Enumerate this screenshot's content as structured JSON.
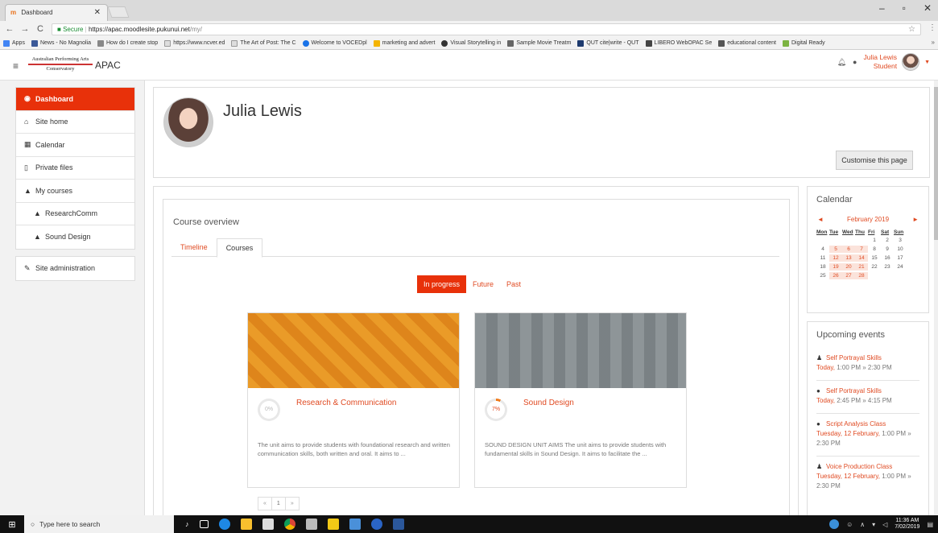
{
  "browser": {
    "tab_title": "Dashboard",
    "secure_label": "Secure",
    "url_host": "https://apac.moodlesite.pukunui.net",
    "url_path": "/my/",
    "bookmarks": [
      "Apps",
      "News - No Magnolia",
      "How do I create stop",
      "https://www.ncver.ed",
      "The Art of Post: The C",
      "Welcome to VOCEDpl",
      "marketing and advert",
      "Visual Storytelling in",
      "Sample Movie Treatm",
      "QUT cite|write - QUT",
      "LIBERO WebOPAC Se",
      "educational content",
      "Digital Ready"
    ]
  },
  "navbar": {
    "logo_line1": "Australian Performing Arts",
    "logo_line2": "Conservatory",
    "site_name": "APAC",
    "user_name": "Julia Lewis",
    "user_role": "Student"
  },
  "drawer": {
    "items": [
      {
        "label": "Dashboard",
        "icon": "dashboard-icon"
      },
      {
        "label": "Site home",
        "icon": "home-icon"
      },
      {
        "label": "Calendar",
        "icon": "calendar-icon"
      },
      {
        "label": "Private files",
        "icon": "file-icon"
      },
      {
        "label": "My courses",
        "icon": "graduation-cap-icon"
      },
      {
        "label": "ResearchComm",
        "icon": "graduation-cap-icon"
      },
      {
        "label": "Sound Design",
        "icon": "graduation-cap-icon"
      }
    ],
    "admin": {
      "label": "Site administration",
      "icon": "wrench-icon"
    }
  },
  "header": {
    "name": "Julia Lewis",
    "customise_label": "Customise this page"
  },
  "overview": {
    "title": "Course overview",
    "tabs": [
      "Timeline",
      "Courses"
    ],
    "active_tab": "Courses",
    "filters": [
      "In progress",
      "Future",
      "Past"
    ],
    "active_filter": "In progress",
    "courses": [
      {
        "title": "Research & Communication",
        "progress": "0%",
        "description": "The unit aims to provide students with foundational research and written communication skills, both written and oral. It aims to ...",
        "image_color": "#f2c15a"
      },
      {
        "title": "Sound Design",
        "progress": "7%",
        "description": "SOUND DESIGN UNIT AIMS  The unit aims to provide students with fundamental skills in Sound Design.  It aims to facilitate the ...",
        "image_color": "#b8bdbf"
      }
    ],
    "pager": [
      "«",
      "1",
      "»"
    ]
  },
  "calendar": {
    "title": "Calendar",
    "prev": "◄",
    "month": "February 2019",
    "next": "►",
    "weekdays": [
      "Mon",
      "Tue",
      "Wed",
      "Thu",
      "Fri",
      "Sat",
      "Sun"
    ],
    "days": [
      "",
      "",
      "",
      "",
      "1",
      "2",
      "3",
      "4",
      "5",
      "6",
      "7",
      "8",
      "9",
      "10",
      "11",
      "12",
      "13",
      "14",
      "15",
      "16",
      "17",
      "18",
      "19",
      "20",
      "21",
      "22",
      "23",
      "24",
      "25",
      "26",
      "27",
      "28",
      "",
      "",
      ""
    ],
    "event_days": [
      "5",
      "6",
      "7",
      "12",
      "13",
      "14",
      "19",
      "20",
      "21",
      "26",
      "27",
      "28"
    ]
  },
  "events": {
    "title": "Upcoming events",
    "items": [
      {
        "name": "Self Portrayal Skills",
        "date_link": "Today,",
        "time": "1:00 PM » 2:30 PM",
        "icon": "user-icon"
      },
      {
        "name": "Self Portrayal Skills",
        "date_link": "Today,",
        "time": "2:45 PM » 4:15 PM",
        "icon": "globe-icon"
      },
      {
        "name": "Script Analysis Class",
        "date_link": "Tuesday, 12 February,",
        "time": "1:00 PM » 2:30 PM",
        "icon": "globe-icon"
      },
      {
        "name": "Voice Production Class",
        "date_link": "Tuesday, 12 February,",
        "time": "1:00 PM » 2:30 PM",
        "icon": "user-icon"
      }
    ]
  },
  "taskbar": {
    "search_placeholder": "Type here to search",
    "time": "11:36 AM",
    "date": "7/02/2019"
  }
}
